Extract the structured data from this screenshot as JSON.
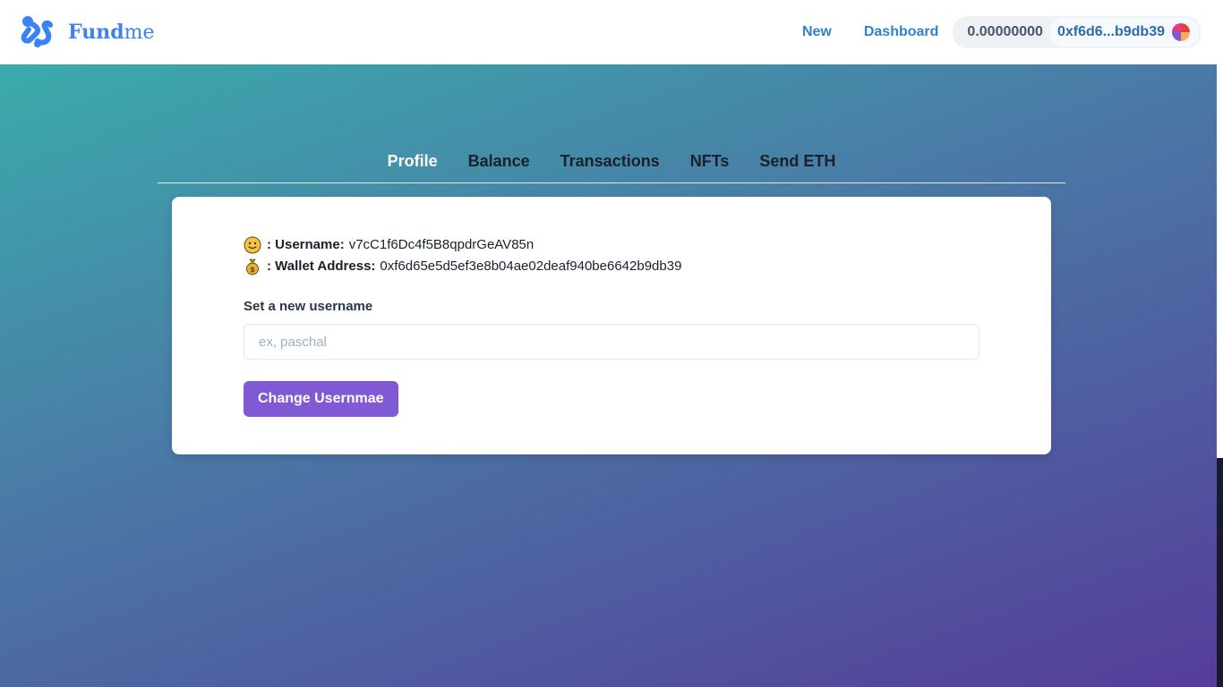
{
  "header": {
    "brand": {
      "name_bold": "Fund",
      "name_light": "me"
    },
    "nav": {
      "new_label": "New",
      "dashboard_label": "Dashboard"
    },
    "wallet": {
      "balance": "0.00000000",
      "address_short": "0xf6d6...b9db39"
    }
  },
  "tabs": [
    {
      "label": "Profile",
      "active": true
    },
    {
      "label": "Balance",
      "active": false
    },
    {
      "label": "Transactions",
      "active": false
    },
    {
      "label": "NFTs",
      "active": false
    },
    {
      "label": "Send ETH",
      "active": false
    }
  ],
  "profile": {
    "username_label": ": Username:",
    "username_value": "v7cC1f6Dc4f5B8qpdrGeAV85n",
    "wallet_label": ": Wallet Address:",
    "wallet_value": "0xf6d65e5d5ef3e8b04ae02deaf940be6642b9db39",
    "set_username_label": "Set a new username",
    "input_placeholder": "ex, paschal",
    "button_label": "Change Usernmae"
  },
  "icons": {
    "logo": "fundme-logo-icon",
    "username": "smiley-face-icon",
    "wallet": "money-bag-icon",
    "avatar": "wallet-avatar-icon"
  },
  "colors": {
    "brand": "#3b82f6",
    "button": "#805ad5",
    "nav_link": "#3182ce",
    "gradient_start": "#38b2ac",
    "gradient_end": "#553c9a"
  }
}
